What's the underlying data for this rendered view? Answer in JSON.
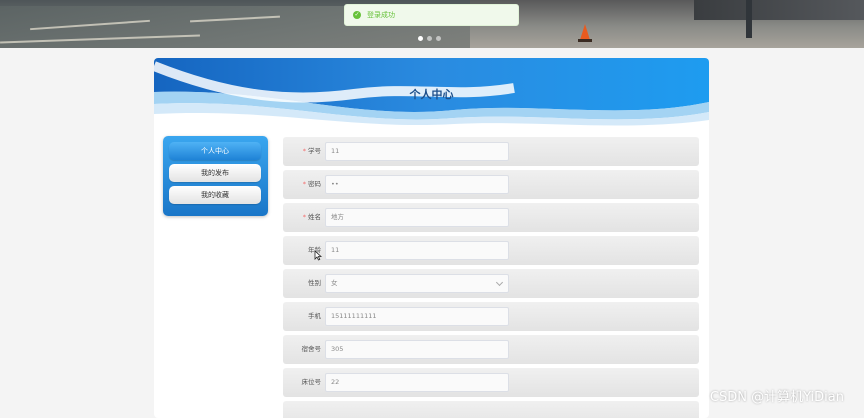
{
  "toast": {
    "message": "登录成功"
  },
  "carousel": {
    "slide_count": 3,
    "active_index": 0
  },
  "page": {
    "title": "个人中心"
  },
  "menu": {
    "items": [
      {
        "label": "个人中心",
        "active": true
      },
      {
        "label": "我的发布",
        "active": false
      },
      {
        "label": "我的收藏",
        "active": false
      }
    ]
  },
  "form": {
    "fields": [
      {
        "label": "学号",
        "required": true,
        "value": "11"
      },
      {
        "label": "密码",
        "required": true,
        "value": "••"
      },
      {
        "label": "姓名",
        "required": true,
        "value": "地方"
      },
      {
        "label": "年龄",
        "required": false,
        "value": "11"
      },
      {
        "label": "性别",
        "required": false,
        "value": "女",
        "type": "select"
      },
      {
        "label": "手机",
        "required": false,
        "value": "15111111111"
      },
      {
        "label": "宿舍号",
        "required": false,
        "value": "305"
      },
      {
        "label": "床位号",
        "required": false,
        "value": "22"
      }
    ]
  },
  "watermark": {
    "text": "CSDN @计算机YiDian"
  },
  "colors": {
    "accent": "#1a76c8",
    "title": "#1d4f8b",
    "success": "#67c23a",
    "required": "#f56c6c"
  },
  "icons": {
    "toast": "check-circle-icon",
    "select": "chevron-down-icon",
    "pointer": "mouse-cursor-icon"
  }
}
